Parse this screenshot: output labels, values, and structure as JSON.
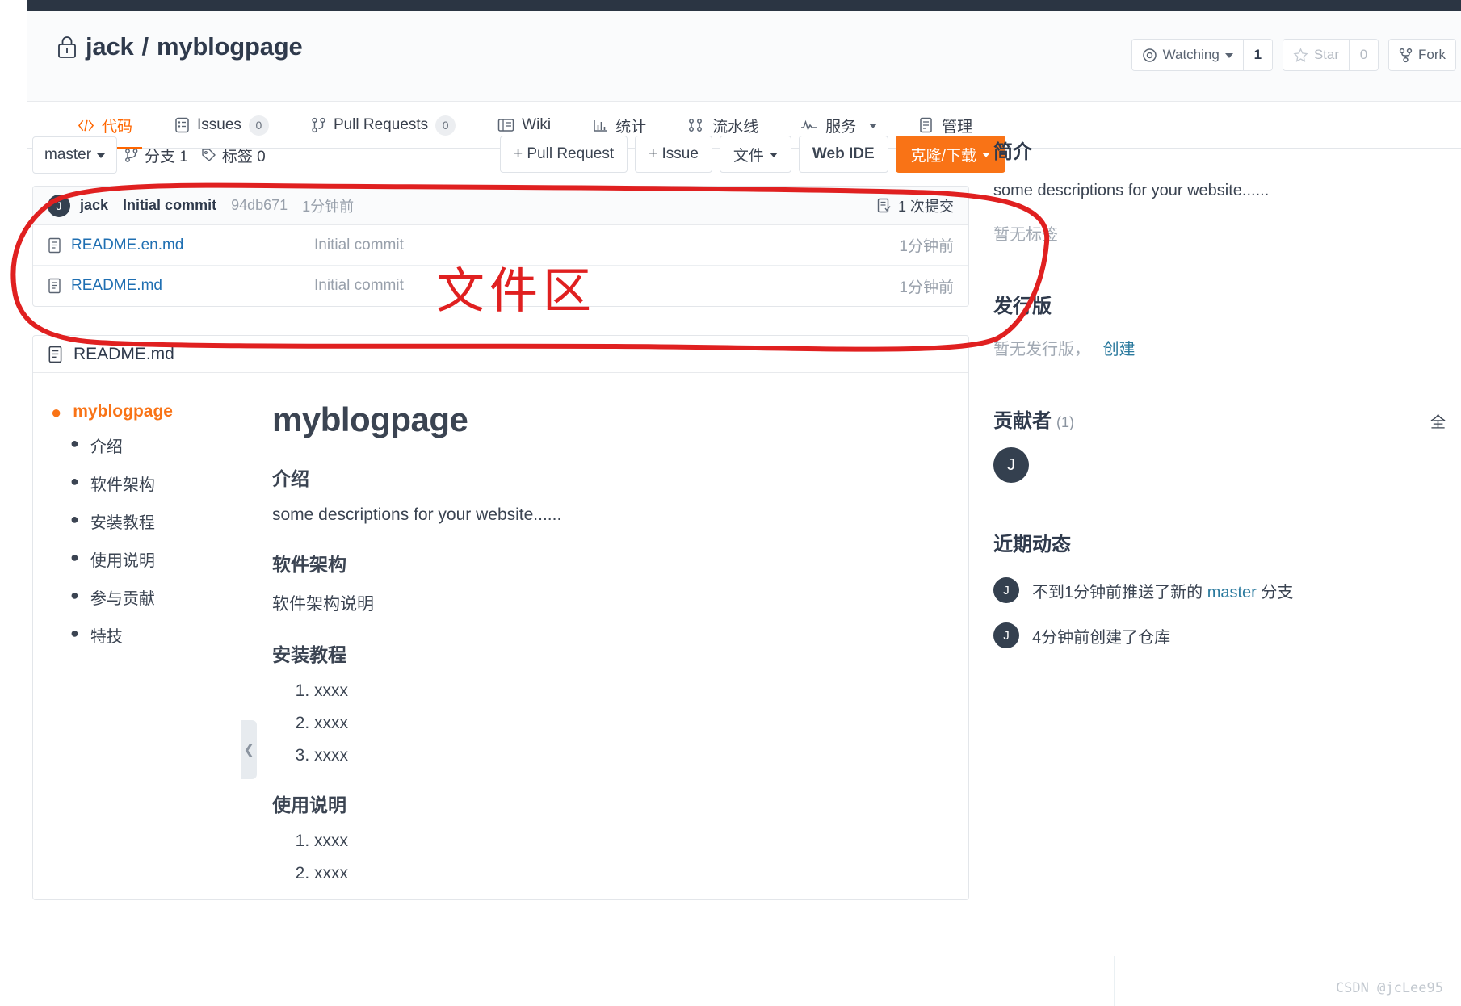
{
  "window": {
    "top_strip_color": "#2b3543"
  },
  "repo": {
    "owner": "jack",
    "separator": "/",
    "name": "myblogpage",
    "lock_icon": "lock-icon"
  },
  "actions": {
    "watching_label": "Watching",
    "watching_count": "1",
    "star_label": "Star",
    "star_count": "0",
    "fork_label": "Fork"
  },
  "nav_tabs": [
    {
      "label": "代码",
      "icon": "code-icon",
      "badge": "",
      "active": true
    },
    {
      "label": "Issues",
      "icon": "issues-icon",
      "badge": "0",
      "active": false
    },
    {
      "label": "Pull Requests",
      "icon": "pull-request-icon",
      "badge": "0",
      "active": false
    },
    {
      "label": "Wiki",
      "icon": "wiki-icon",
      "badge": "",
      "active": false
    },
    {
      "label": "统计",
      "icon": "stats-icon",
      "badge": "",
      "active": false
    },
    {
      "label": "流水线",
      "icon": "pipeline-icon",
      "badge": "",
      "active": false
    },
    {
      "label": "服务",
      "icon": "service-icon",
      "badge": "",
      "active": false
    },
    {
      "label": "管理",
      "icon": "manage-icon",
      "badge": "",
      "active": false
    }
  ],
  "toolbar": {
    "branch": "master",
    "branches_label": "分支 1",
    "tags_label": "标签 0",
    "pull_request_button": "+ Pull Request",
    "issue_button": "+ Issue",
    "files_button": "文件",
    "web_ide_button": "Web IDE",
    "clone_button": "克隆/下载",
    "clone_color": "#f97316"
  },
  "commit_bar": {
    "avatar_initial": "J",
    "author": "jack",
    "message": "Initial commit",
    "sha": "94db671",
    "time": "1分钟前",
    "commits_count_label": "1 次提交"
  },
  "files": [
    {
      "icon": "file-text-icon",
      "name": "README.en.md",
      "message": "Initial commit",
      "time": "1分钟前"
    },
    {
      "icon": "file-text-icon",
      "name": "README.md",
      "message": "Initial commit",
      "time": "1分钟前"
    }
  ],
  "readme": {
    "header_title": "README.md",
    "header_icon": "file-text-icon",
    "toc": [
      {
        "level": 1,
        "label": "myblogpage"
      },
      {
        "level": 2,
        "label": "介绍"
      },
      {
        "level": 2,
        "label": "软件架构"
      },
      {
        "level": 2,
        "label": "安装教程"
      },
      {
        "level": 2,
        "label": "使用说明"
      },
      {
        "level": 2,
        "label": "参与贡献"
      },
      {
        "level": 2,
        "label": "特技"
      }
    ],
    "title": "myblogpage",
    "sections": [
      {
        "heading": "介绍",
        "paragraph": "some descriptions for your website......"
      },
      {
        "heading": "软件架构",
        "paragraph": "软件架构说明"
      }
    ],
    "install_heading": "安装教程",
    "install_steps": [
      "xxxx",
      "xxxx",
      "xxxx"
    ],
    "usage_heading": "使用说明",
    "usage_steps": [
      "xxxx",
      "xxxx"
    ],
    "collapse_handle_icon": "chevron-left-icon"
  },
  "sidebar": {
    "about_heading": "简介",
    "about_text": "some descriptions for your website......",
    "no_tags_text": "暂无标签",
    "releases_heading": "发行版",
    "no_release_text": "暂无发行版，",
    "create_release_link": "创建",
    "contributors_heading": "贡献者",
    "contributors_count": "(1)",
    "contributors_all_label": "全",
    "contributor_initial": "J",
    "activity_heading": "近期动态",
    "activities": [
      {
        "avatar_initial": "J",
        "prefix": "不到1分钟前推送了新的 ",
        "link": "master",
        "suffix": " 分支"
      },
      {
        "avatar_initial": "J",
        "prefix": "4分钟前创建了仓库",
        "link": "",
        "suffix": ""
      }
    ]
  },
  "annotation": {
    "text": "文件区",
    "color": "#e02020"
  },
  "watermark": {
    "text": "CSDN @jcLee95"
  }
}
